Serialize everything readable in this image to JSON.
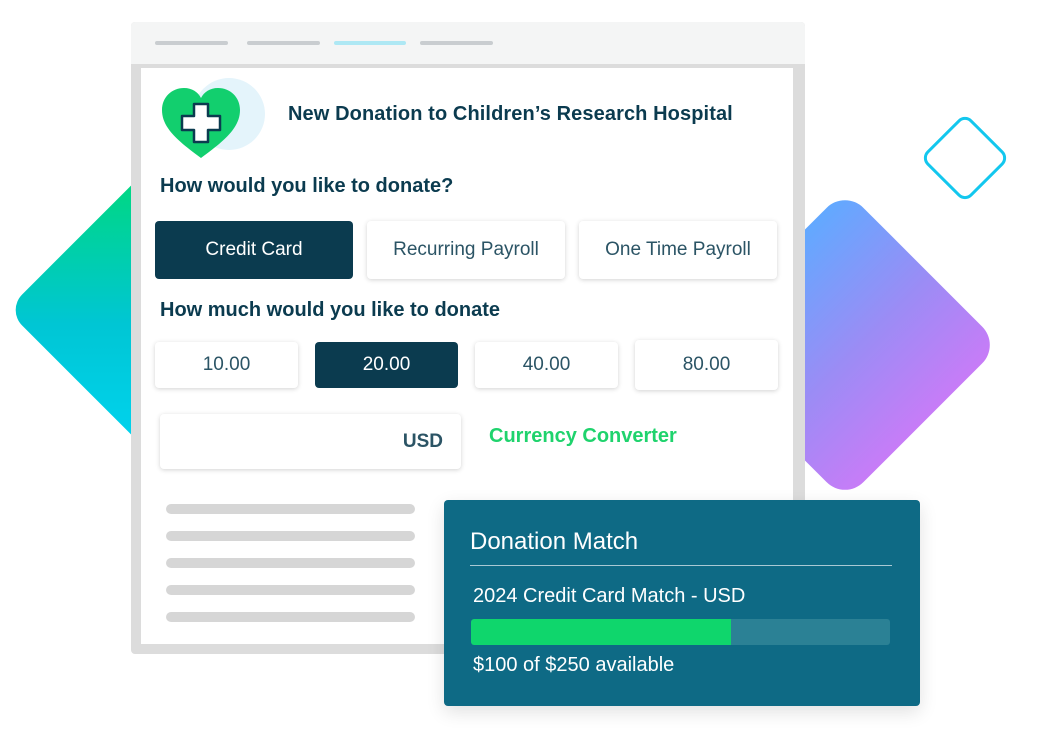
{
  "header": {
    "title": "New Donation to Children’s Research Hospital",
    "logo_icon": "heart-plus-icon"
  },
  "donation_method": {
    "question": "How would you like to donate?",
    "options": [
      {
        "label": "Credit Card",
        "selected": true
      },
      {
        "label": "Recurring Payroll",
        "selected": false
      },
      {
        "label": "One Time Payroll",
        "selected": false
      }
    ]
  },
  "donation_amount": {
    "question": "How much would you like to donate",
    "options": [
      {
        "label": "10.00",
        "selected": false
      },
      {
        "label": "20.00",
        "selected": true
      },
      {
        "label": "40.00",
        "selected": false
      },
      {
        "label": "80.00",
        "selected": false
      }
    ],
    "currency": "USD",
    "converter_label": "Currency Converter"
  },
  "match": {
    "title": "Donation Match",
    "name": "2024 Credit Card Match - USD",
    "used_fraction": 0.62,
    "availability": "$100 of $250 available"
  },
  "colors": {
    "primary_dark": "#0b3b4f",
    "accent_green": "#1fd36d",
    "card_teal": "#0e6a85",
    "progress_green": "#0fd66c"
  }
}
